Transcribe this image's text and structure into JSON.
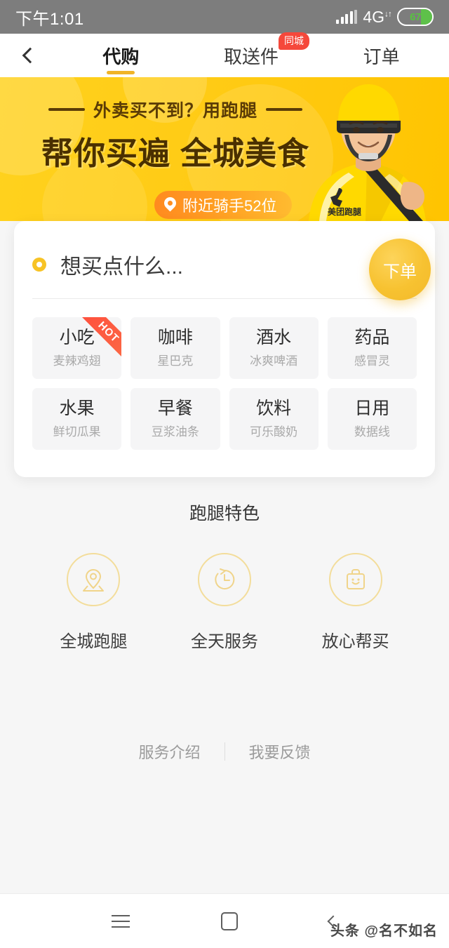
{
  "status_bar": {
    "time": "下午1:01",
    "network": "4G",
    "network_sub": "↓↑",
    "battery_percent": "67",
    "battery_level": 67
  },
  "nav": {
    "back_icon": "chevron-left-icon",
    "tabs": [
      {
        "label": "代购",
        "active": true,
        "badge": ""
      },
      {
        "label": "取送件",
        "active": false,
        "badge": "同城"
      },
      {
        "label": "订单",
        "active": false,
        "badge": ""
      }
    ]
  },
  "banner": {
    "headline_small": "外卖买不到？用跑腿",
    "headline_main_1": "帮你买遍",
    "headline_main_2": "全城美食",
    "rider_badge": "附近骑手52位",
    "courier_uniform_text": "美团跑腿"
  },
  "search_card": {
    "input_placeholder": "想买点什么...",
    "order_button": "下单",
    "categories": [
      {
        "title": "小吃",
        "subtitle": "麦辣鸡翅",
        "tag": "HOT"
      },
      {
        "title": "咖啡",
        "subtitle": "星巴克",
        "tag": ""
      },
      {
        "title": "酒水",
        "subtitle": "冰爽啤酒",
        "tag": ""
      },
      {
        "title": "药品",
        "subtitle": "感冒灵",
        "tag": ""
      },
      {
        "title": "水果",
        "subtitle": "鲜切瓜果",
        "tag": ""
      },
      {
        "title": "早餐",
        "subtitle": "豆浆油条",
        "tag": ""
      },
      {
        "title": "饮料",
        "subtitle": "可乐酸奶",
        "tag": ""
      },
      {
        "title": "日用",
        "subtitle": "数据线",
        "tag": ""
      }
    ]
  },
  "features": {
    "title": "跑腿特色",
    "items": [
      {
        "label": "全城跑腿",
        "icon": "map-pin-icon"
      },
      {
        "label": "全天服务",
        "icon": "clock-refresh-icon"
      },
      {
        "label": "放心帮买",
        "icon": "shopping-bag-smile-icon"
      }
    ]
  },
  "footer": {
    "links": [
      {
        "label": "服务介绍"
      },
      {
        "label": "我要反馈"
      }
    ]
  },
  "system_nav": {
    "menu_icon": "hamburger-icon",
    "home_icon": "square-icon",
    "back_icon": "chevron-left-icon"
  },
  "watermark": "头条 @名不如名",
  "colors": {
    "brand_yellow": "#FFD21E",
    "accent_amber": "#F0B429",
    "badge_red": "#F5483B",
    "rider_orange": "#FF8A1F",
    "status_gray": "#7D7D7D",
    "battery_green": "#57C23F"
  }
}
